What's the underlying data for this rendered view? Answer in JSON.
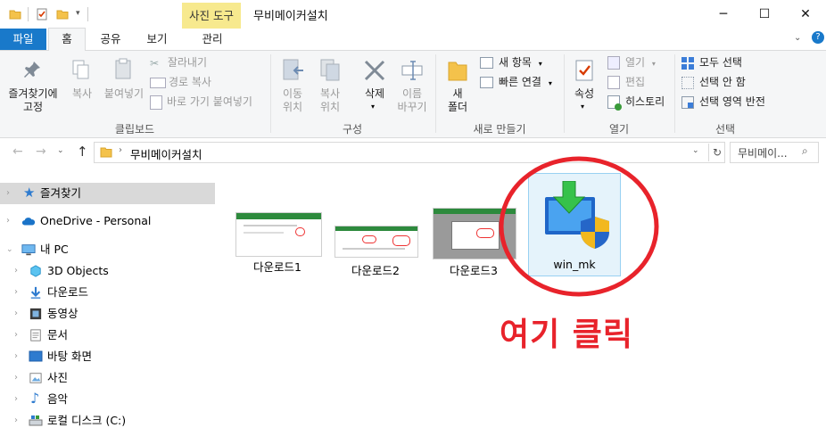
{
  "window": {
    "title": "무비메이커설치",
    "tool_tab": "사진 도구",
    "controls": {
      "minimize": "─",
      "maximize": "☐",
      "close": "✕"
    }
  },
  "ribbon_tabs": [
    "파일",
    "홈",
    "공유",
    "보기",
    "관리"
  ],
  "ribbon": {
    "clipboard": {
      "label": "클립보드",
      "pin": "즐겨찾기에\n고정",
      "copy": "복사",
      "paste": "붙여넣기",
      "cut": "잘라내기",
      "copy_path": "경로 복사",
      "paste_shortcut": "바로 가기 붙여넣기"
    },
    "organize": {
      "label": "구성",
      "move_to": "이동\n위치",
      "copy_to": "복사\n위치",
      "delete": "삭제",
      "rename": "이름\n바꾸기"
    },
    "new": {
      "label": "새로 만들기",
      "new_folder": "새\n폴더",
      "new_item": "새 항목",
      "easy_access": "빠른 연결"
    },
    "open": {
      "label": "열기",
      "properties": "속성",
      "open": "열기",
      "edit": "편집",
      "history": "히스토리"
    },
    "select": {
      "label": "선택",
      "select_all": "모두 선택",
      "select_none": "선택 안 함",
      "invert": "선택 영역 반전"
    }
  },
  "address": {
    "path": "무비메이커설치",
    "search_placeholder": "무비메이..."
  },
  "nav": [
    {
      "label": "즐겨찾기",
      "icon": "star-icon",
      "selected": true
    },
    {
      "label": "OneDrive - Personal",
      "icon": "cloud-icon"
    },
    {
      "label": "내 PC",
      "icon": "pc-icon"
    },
    {
      "label": "3D Objects",
      "icon": "cube-icon"
    },
    {
      "label": "다운로드",
      "icon": "download-icon"
    },
    {
      "label": "동영상",
      "icon": "video-icon"
    },
    {
      "label": "문서",
      "icon": "document-icon"
    },
    {
      "label": "바탕 화면",
      "icon": "desktop-icon"
    },
    {
      "label": "사진",
      "icon": "picture-icon"
    },
    {
      "label": "음악",
      "icon": "music-icon"
    },
    {
      "label": "로컬 디스크 (C:)",
      "icon": "drive-icon"
    }
  ],
  "files": [
    {
      "name": "다운로드1"
    },
    {
      "name": "다운로드2"
    },
    {
      "name": "다운로드3"
    },
    {
      "name": "win_mk"
    }
  ],
  "annotation": {
    "callout": "여기 클릭",
    "circle_color": "#e8232b"
  },
  "colors": {
    "file_tab": "#1979ca",
    "tool_tab": "#f7e98e",
    "selection": "#d9d9d9"
  }
}
